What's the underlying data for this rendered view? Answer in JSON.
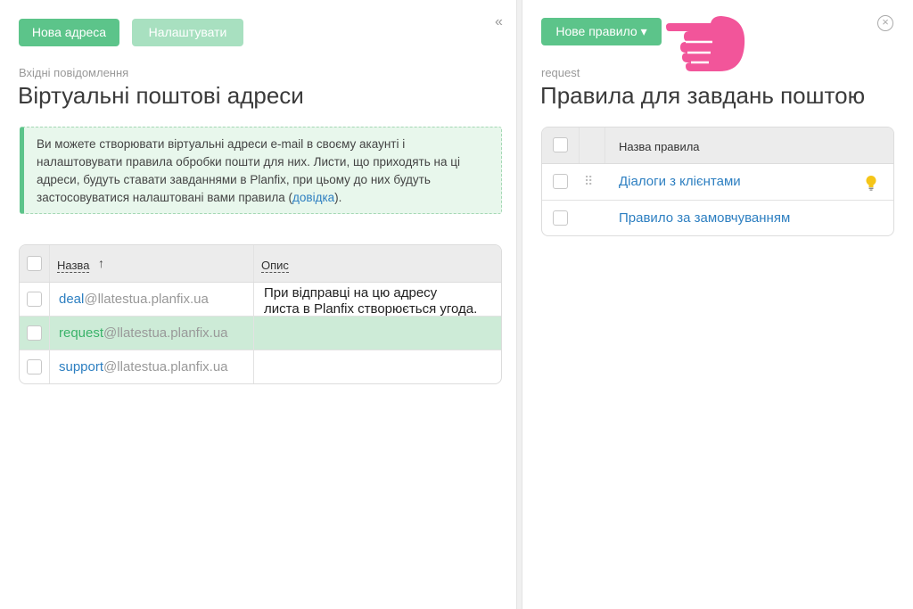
{
  "left": {
    "buttons": {
      "new_address": "Нова адреса",
      "configure": "Налаштувати"
    },
    "breadcrumb": "Вхідні повідомлення",
    "title": "Віртуальні поштові адреси",
    "info": {
      "text": "Ви можете створювати віртуальні адреси e-mail в своєму акаунті і налаштовувати правила обробки пошти для них. Листи, що приходять на ці адреси, будуть ставати завданнями в Planfix, при цьому до них будуть застосовуватися налаштовані вами правила (",
      "link": "довідка",
      "suffix": ")."
    },
    "table": {
      "columns": {
        "name": "Назва",
        "description": "Опис"
      },
      "sort_icon": "arrow-up",
      "rows": [
        {
          "local": "deal",
          "domain": "@llatestua.planfix.ua",
          "description_line1": "При відправці на цю адресу",
          "description_line2": "листа в Planfix створюється угода."
        },
        {
          "local": "request",
          "domain": "@llatestua.planfix.ua",
          "description_line1": "",
          "description_line2": ""
        },
        {
          "local": "support",
          "domain": "@llatestua.planfix.ua",
          "description_line1": "",
          "description_line2": ""
        }
      ]
    }
  },
  "right": {
    "new_rule_button": "Нове правило ▾",
    "breadcrumb": "request",
    "title": "Правила для завдань поштою",
    "table": {
      "column_name": "Назва правила",
      "rows": [
        {
          "label": "Діалоги з клієнтами",
          "icon": "lightbulb-icon"
        },
        {
          "label": "Правило за замовчуванням"
        }
      ]
    }
  },
  "colors": {
    "accent": "#5cc48a",
    "link": "#2d7fc1",
    "pointer": "#f2559a",
    "selected_row": "#cdebd7"
  }
}
